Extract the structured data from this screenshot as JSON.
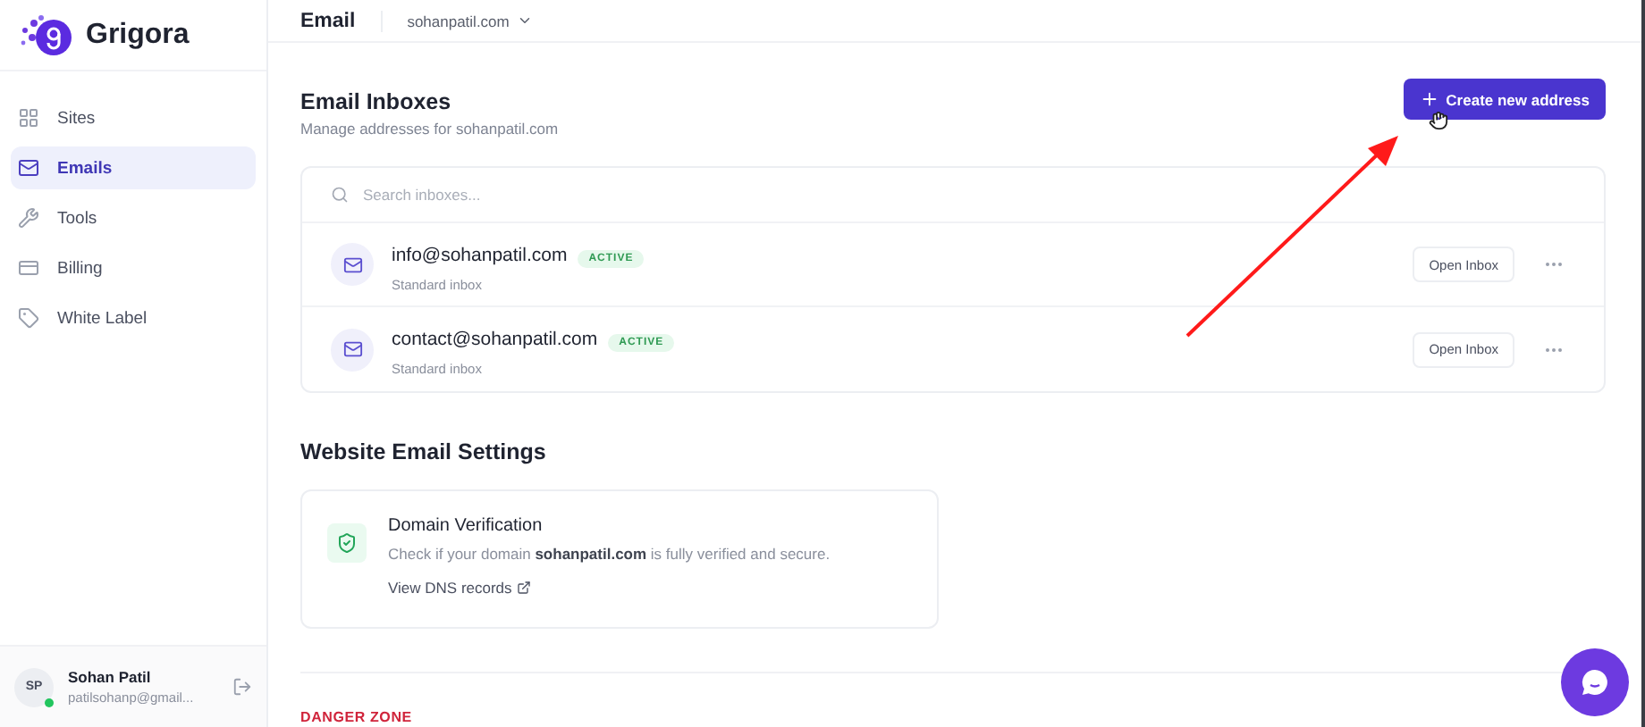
{
  "brand": {
    "name": "Grigora"
  },
  "sidebar": {
    "items": [
      {
        "label": "Sites",
        "selected": false
      },
      {
        "label": "Emails",
        "selected": true
      },
      {
        "label": "Tools",
        "selected": false
      },
      {
        "label": "Billing",
        "selected": false
      },
      {
        "label": "White Label",
        "selected": false
      }
    ]
  },
  "user": {
    "initials": "SP",
    "name": "Sohan Patil",
    "email": "patilsohanp@gmail...",
    "online": true
  },
  "topbar": {
    "title": "Email",
    "domain": "sohanpatil.com"
  },
  "inboxes": {
    "title": "Email Inboxes",
    "subtitle": "Manage addresses for sohanpatil.com",
    "create_button": "Create new address",
    "search": {
      "placeholder": "Search inboxes..."
    },
    "rows": [
      {
        "address": "info@sohanpatil.com",
        "status": "ACTIVE",
        "type": "Standard inbox",
        "action": "Open Inbox"
      },
      {
        "address": "contact@sohanpatil.com",
        "status": "ACTIVE",
        "type": "Standard inbox",
        "action": "Open Inbox"
      }
    ]
  },
  "settings": {
    "title": "Website Email Settings",
    "card": {
      "title": "Domain Verification",
      "text": "Check if your domain **sohanpatil.com** is fully verified and secure.",
      "link": "View DNS records"
    }
  },
  "danger_zone": {
    "title": "DANGER ZONE"
  }
}
